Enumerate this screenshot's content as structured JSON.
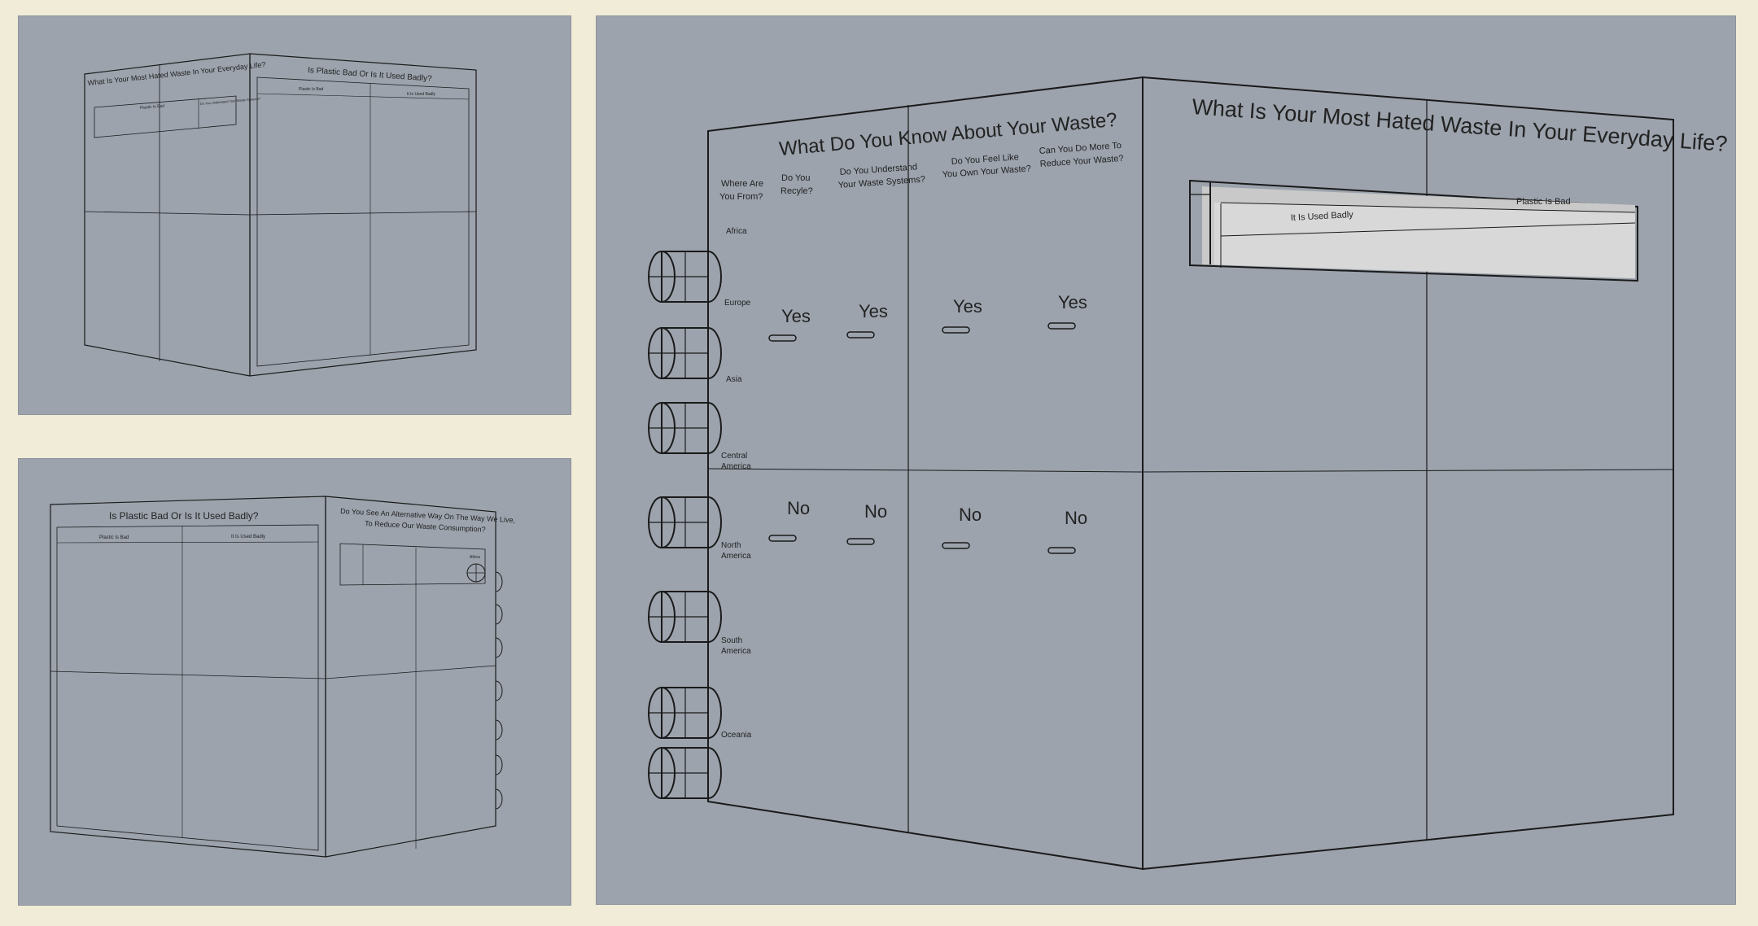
{
  "colors": {
    "background": "#f1ecd7",
    "viewport": "#9ca3ad",
    "face_light": "#ececec",
    "face_dark": "#a9a9a9",
    "edge": "#1a1a1a"
  },
  "viewport_top": {
    "left_face_title": "What Is Your Most Hated Waste In Your Everyday Life?",
    "left_face_slot_labels": [
      "Plastic Is Bad",
      "Do You Understand Your Waste Systems?"
    ],
    "right_face_title": "Is Plastic Bad Or Is It Used Badly?",
    "right_face_col1": "Plastic Is Bad",
    "right_face_col2": "It Is Used Badly"
  },
  "viewport_bottom": {
    "left_face_title": "Is Plastic Bad Or Is It Used Badly?",
    "left_face_col1": "Plastic Is Bad",
    "left_face_col2": "It Is Used Badly",
    "right_face_title_line1": "Do You See An Alternative Way On The Way We Live,",
    "right_face_title_line2": "To Reduce Our Waste Consumption?",
    "right_face_slot_label": "Africa"
  },
  "viewport_main": {
    "left_face_title": "What Do You Know About Your Waste?",
    "questions": [
      {
        "line1": "Where Are",
        "line2": "You From?"
      },
      {
        "line1": "Do You",
        "line2": "Recyle?"
      },
      {
        "line1": "Do You Understand",
        "line2": "Your Waste Systems?"
      },
      {
        "line1": "Do You Feel Like",
        "line2": "You Own Your Waste?"
      },
      {
        "line1": "Can You Do More To",
        "line2": "Reduce Your Waste?"
      }
    ],
    "regions": [
      "Africa",
      "Europe",
      "Asia",
      "Central America",
      "North America",
      "South America",
      "Oceania"
    ],
    "yes_label": "Yes",
    "no_label": "No",
    "right_face_title": "What Is Your Most Hated Waste In Your Everyday Life?",
    "slot_label_left": "It Is Used Badly",
    "slot_label_right": "Plastic Is Bad"
  }
}
